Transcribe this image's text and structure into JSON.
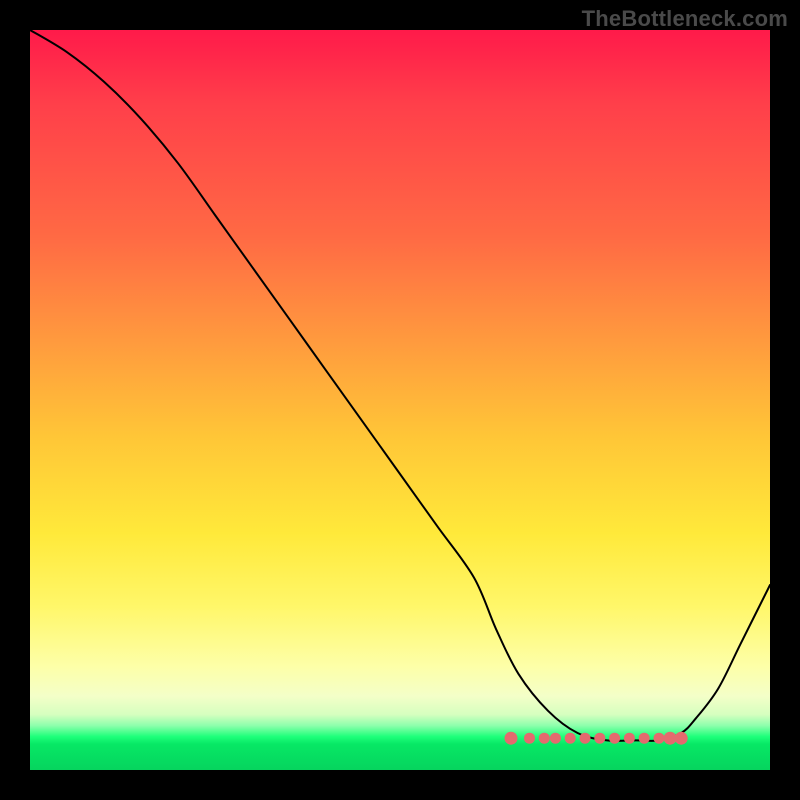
{
  "watermark": "TheBottleneck.com",
  "chart_data": {
    "type": "line",
    "title": "",
    "xlabel": "",
    "ylabel": "",
    "x": [
      0,
      5,
      10,
      15,
      20,
      25,
      30,
      35,
      40,
      45,
      50,
      55,
      60,
      63,
      66,
      70,
      74,
      78,
      82,
      85,
      88,
      90,
      93,
      96,
      100
    ],
    "y": [
      100,
      97,
      93,
      88,
      82,
      75,
      68,
      61,
      54,
      47,
      40,
      33,
      26,
      19,
      13,
      8,
      5,
      4,
      4,
      4,
      5,
      7,
      11,
      17,
      25
    ],
    "xlim": [
      0,
      100
    ],
    "ylim": [
      0,
      100
    ],
    "markers_x": [
      65,
      67.5,
      69.5,
      71,
      73,
      75,
      77,
      79,
      81,
      83,
      85,
      86.5,
      88
    ],
    "note": "y maps to vertical position where 0 is bottom (green) and 100 is top (red); curve is a bottleneck V with flat minimum around x≈72–85"
  }
}
